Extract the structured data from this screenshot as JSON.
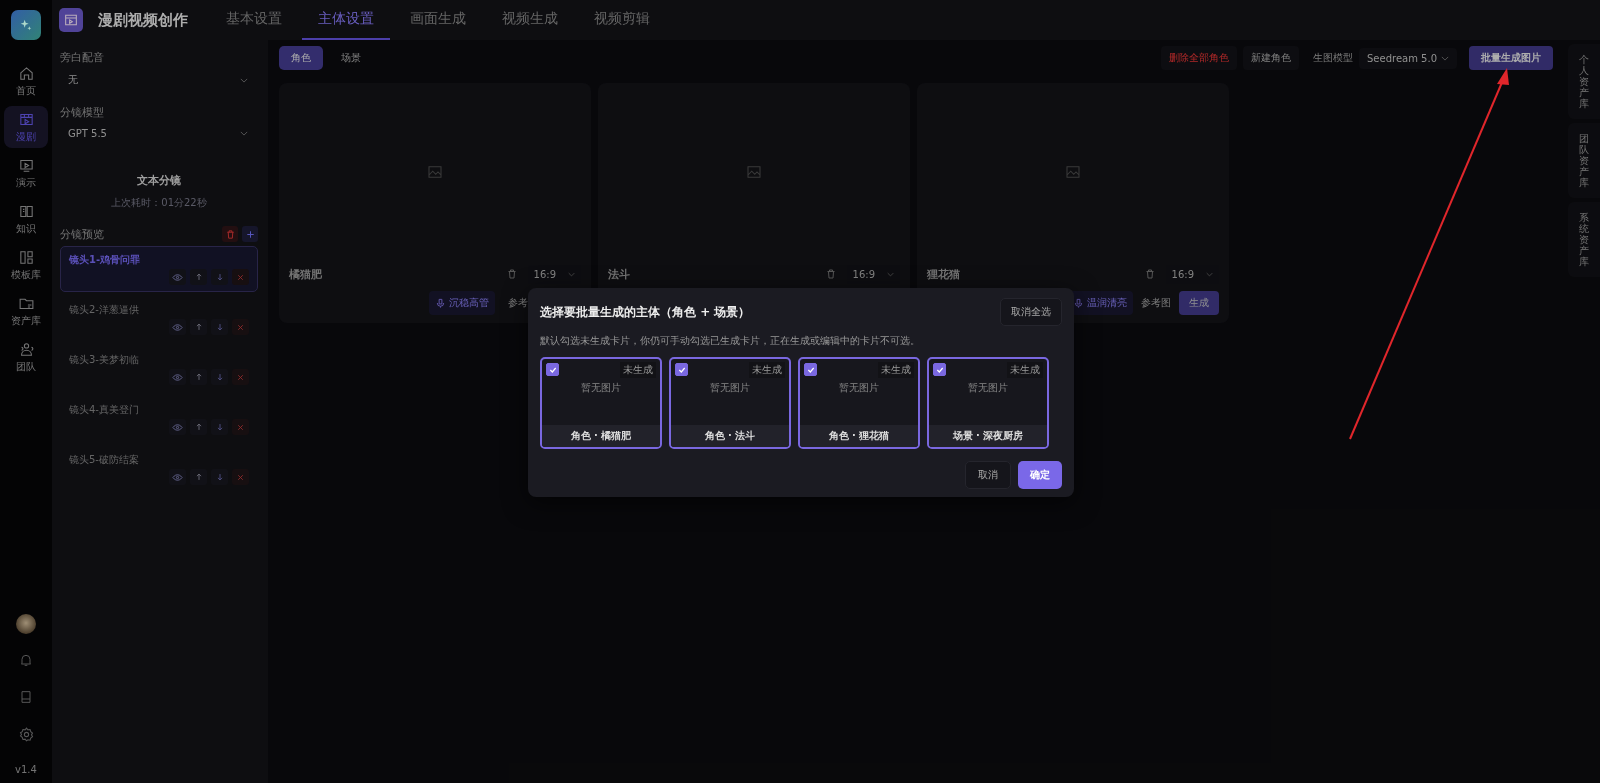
{
  "app": {
    "title": "漫剧视频创作"
  },
  "nav_tabs": [
    {
      "label": "基本设置",
      "selected": false
    },
    {
      "label": "主体设置",
      "selected": true
    },
    {
      "label": "画面生成",
      "selected": false
    },
    {
      "label": "视频生成",
      "selected": false
    },
    {
      "label": "视频剪辑",
      "selected": false
    }
  ],
  "rail": {
    "items": [
      {
        "label": "首页",
        "selected": false
      },
      {
        "label": "漫剧",
        "selected": true
      },
      {
        "label": "演示",
        "selected": false
      },
      {
        "label": "知识",
        "selected": false
      },
      {
        "label": "模板库",
        "selected": false
      },
      {
        "label": "资产库",
        "selected": false
      },
      {
        "label": "团队",
        "selected": false
      }
    ],
    "version": "v1.4"
  },
  "left_panel": {
    "narration": {
      "label": "旁白配音",
      "value": "无"
    },
    "model": {
      "label": "分镜模型",
      "value": "GPT 5.5"
    },
    "split_button": "文本分镜",
    "last_duration": "上次耗时：01分22秒",
    "preview_label": "分镜预览",
    "shots": [
      {
        "title": "镜头1-鸡骨问罪",
        "selected": true
      },
      {
        "title": "镜头2-洋葱逼供",
        "selected": false
      },
      {
        "title": "镜头3-美梦初临",
        "selected": false
      },
      {
        "title": "镜头4-真美登门",
        "selected": false
      },
      {
        "title": "镜头5-破防结案",
        "selected": false
      }
    ]
  },
  "toolbar": {
    "tabs": [
      {
        "label": "角色",
        "selected": true
      },
      {
        "label": "场景",
        "selected": false
      }
    ],
    "delete_all": "删除全部角色",
    "new": "新建角色",
    "model_label": "生图模型",
    "model_value": "Seedream 5.0",
    "batch_button": "批量生成图片"
  },
  "cards": [
    {
      "name": "橘猫肥",
      "ratio": "16:9",
      "voice": "沉稳高管",
      "reference": "参考"
    },
    {
      "name": "法斗",
      "ratio": "16:9"
    },
    {
      "name": "狸花猫",
      "ratio": "16:9",
      "voice": "温润清亮",
      "reference": "参考图",
      "generate": "生成"
    }
  ],
  "asset_tabs": [
    "个人资产库",
    "团队资产库",
    "系统资产库"
  ],
  "dialog": {
    "title": "选择要批量生成的主体（角色 + 场景）",
    "deselect_all": "取消全选",
    "description": "默认勾选未生成卡片，你仍可手动勾选已生成卡片，正在生成或编辑中的卡片不可选。",
    "items": [
      {
        "label": "角色 · 橘猫肥",
        "status": "未生成",
        "placeholder": "暂无图片",
        "checked": true
      },
      {
        "label": "角色 · 法斗",
        "status": "未生成",
        "placeholder": "暂无图片",
        "checked": true
      },
      {
        "label": "角色 · 狸花猫",
        "status": "未生成",
        "placeholder": "暂无图片",
        "checked": true
      },
      {
        "label": "场景 · 深夜厨房",
        "status": "未生成",
        "placeholder": "暂无图片",
        "checked": true
      }
    ],
    "cancel": "取消",
    "confirm": "确定"
  }
}
